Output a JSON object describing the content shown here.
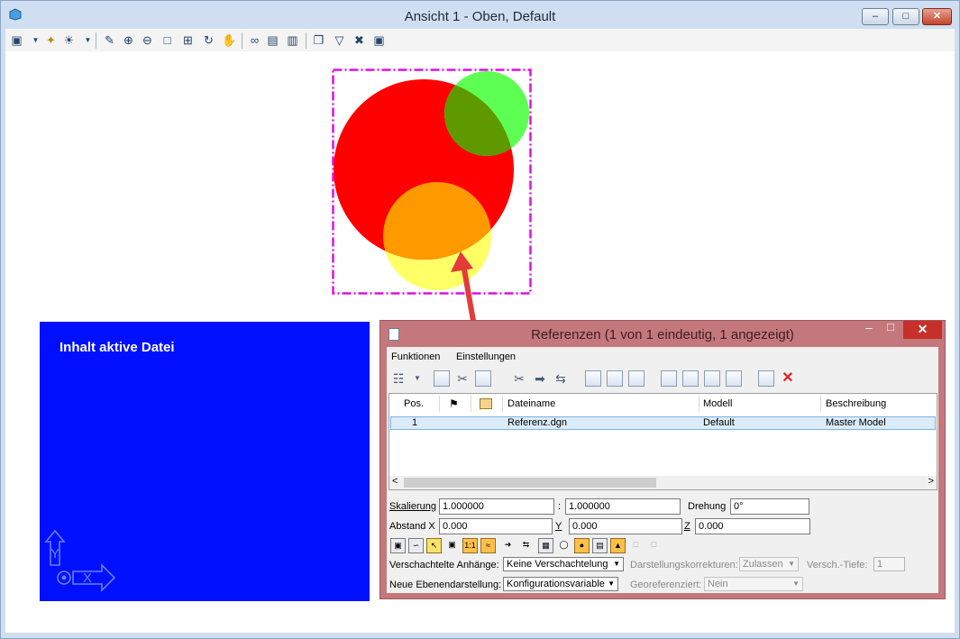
{
  "window": {
    "title": "Ansicht 1 - Oben, Default",
    "min_label": "–",
    "max_label": "□",
    "close_label": "✕"
  },
  "toolbar": {
    "icons": [
      "view-groups-icon",
      "view-attributes-icon",
      "view-display-icon",
      "update-view-icon",
      "zoom-in-icon",
      "zoom-out-icon",
      "window-area-icon",
      "fit-view-icon",
      "rotate-view-icon",
      "pan-view-icon",
      "walk-icon",
      "previous-view-icon",
      "next-view-icon",
      "copy-view-icon",
      "clip-volume-icon",
      "clip-mask-icon",
      "view-camera-icon"
    ]
  },
  "canvas": {
    "panel_label": "Inhalt aktive Datei",
    "axis_y": "Y",
    "axis_x": "X",
    "colors": {
      "red_circle": "#ff0000",
      "green_circle": "#5cff52",
      "green_overlap": "#5f9900",
      "orange_overlap": "#ff9900",
      "yellow_circle": "#ffff66",
      "fence": "#e010e0",
      "panel": "#0010ff",
      "arrow": "#e53a3a"
    }
  },
  "dialog": {
    "title": "Referenzen (1 von 1 eindeutig, 1 angezeigt)",
    "close_label": "✕",
    "min_label": "–",
    "max_label": "□",
    "menu": [
      "Funktionen",
      "Einstellungen"
    ],
    "columns": {
      "pos": "Pos.",
      "dateiname": "Dateiname",
      "modell": "Modell",
      "beschreibung": "Beschreibung"
    },
    "rows": [
      {
        "pos": "1",
        "dateiname": "Referenz.dgn",
        "modell": "Default",
        "beschreibung": "Master Model"
      }
    ],
    "scroll_left": "<",
    "scroll_right": ">",
    "skalierung_label": "Skalierung",
    "skalierung_1": "1.000000",
    "skalierung_sep": ":",
    "skalierung_2": "1.000000",
    "drehung_label": "Drehung",
    "drehung_value": "0°",
    "abstand_label": "Abstand X",
    "abstand_x": "0.000",
    "y_label": "Y",
    "abstand_y": "0.000",
    "z_label": "Z",
    "abstand_z": "0.000",
    "verschachtelt_label": "Verschachtelte Anhänge:",
    "verschachtelt_value": "Keine Verschachtelung",
    "darstellung_label": "Darstellungskorrekturen:",
    "darstellung_value": "Zulassen",
    "tiefe_label": "Versch.-Tiefe:",
    "tiefe_value": "1",
    "ebenen_label": "Neue Ebenendarstellung:",
    "ebenen_value": "Konfigurationsvariable",
    "georef_label": "Georeferenziert:",
    "georef_value": "Nein"
  }
}
